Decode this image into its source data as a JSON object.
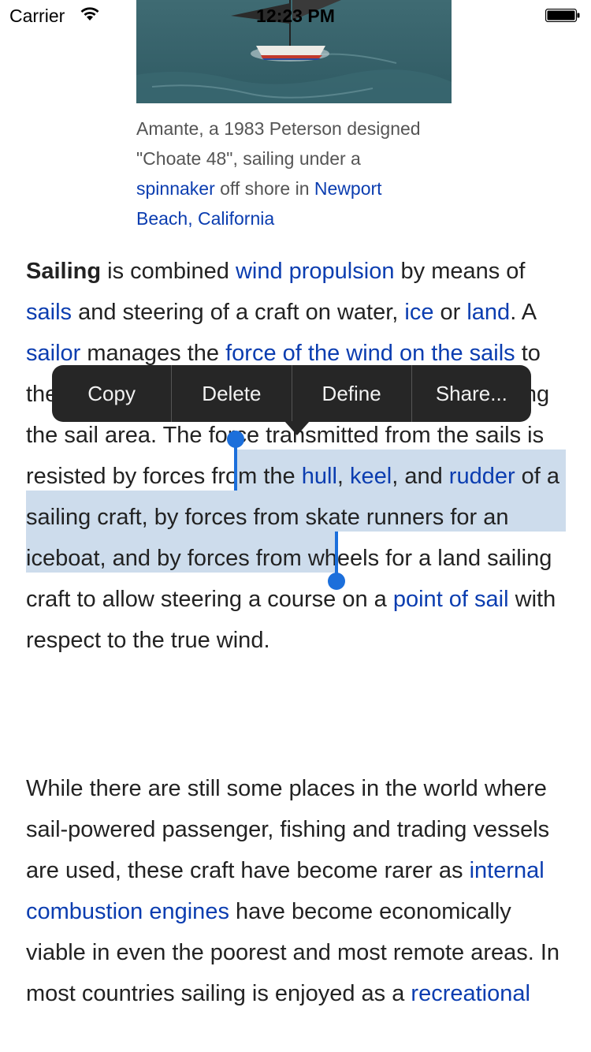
{
  "status_bar": {
    "carrier": "Carrier",
    "time": "12:23 PM"
  },
  "image": {
    "caption_parts": [
      "Amante, a 1983 Peterson designed \"Choate 48\", sailing under a ",
      "spinnaker",
      " off shore in ",
      "Newport Beach, California"
    ]
  },
  "article": {
    "p1": [
      "Sailing",
      " is combined ",
      "wind propulsion",
      " by means of ",
      "sails",
      " and steering of a craft on water, ",
      "ice",
      " or ",
      "land",
      ". A ",
      "sailor",
      " manages the ",
      "force of the wind on the sails",
      " to the moving sailing craft and sometimes by adjusting the sail area. The force transmitted from the sails is resisted by forces from the ",
      "hull",
      ", ",
      "keel",
      ", and ",
      "rudder",
      " of a sailing craft, by forces from skate runners for an iceboat, and by forces from wheels for a land sailing craft to allow steering a course on a ",
      "point of sail",
      " with respect to the true wind."
    ],
    "p2": [
      "While there are still some places in the world where sail-powered passenger, fishing and trading vessels are used, these craft have become rarer as ",
      "internal combustion engines",
      " have become economically viable in even the poorest and most remote areas. In most countries sailing is enjoyed as a ",
      "recreational"
    ]
  },
  "edit_menu": {
    "items": [
      "Copy",
      "Delete",
      "Define",
      "Share..."
    ]
  },
  "colors": {
    "link": "#0b3db0",
    "selection": "#cddcec",
    "handle": "#1c6fdb",
    "menu_bg": "#262626"
  }
}
